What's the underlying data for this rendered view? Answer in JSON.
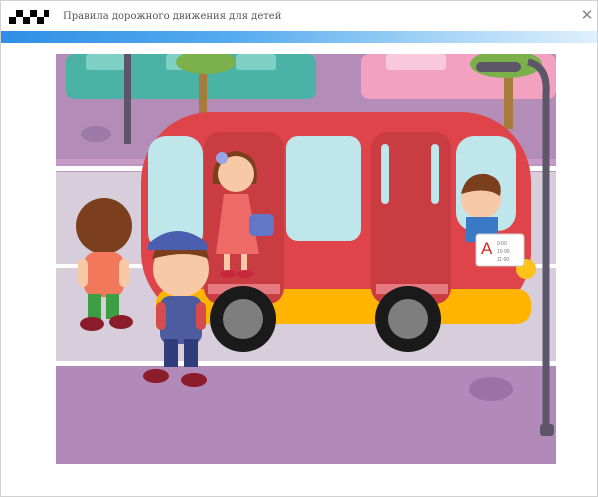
{
  "window": {
    "title": "Правила дорожного движения для детей",
    "close_label": "✕",
    "app_icon": "checkered-flag-icon"
  },
  "scene": {
    "description_icon": "bus-stop-illustration",
    "timetable": {
      "route_letter": "A",
      "times": [
        "9:00",
        "10:00",
        "11:00"
      ]
    }
  },
  "colors": {
    "accent": "#2f8fe6",
    "bus_body": "#e0444b",
    "road": "#b98ebc",
    "sky": "#f3eef5"
  }
}
